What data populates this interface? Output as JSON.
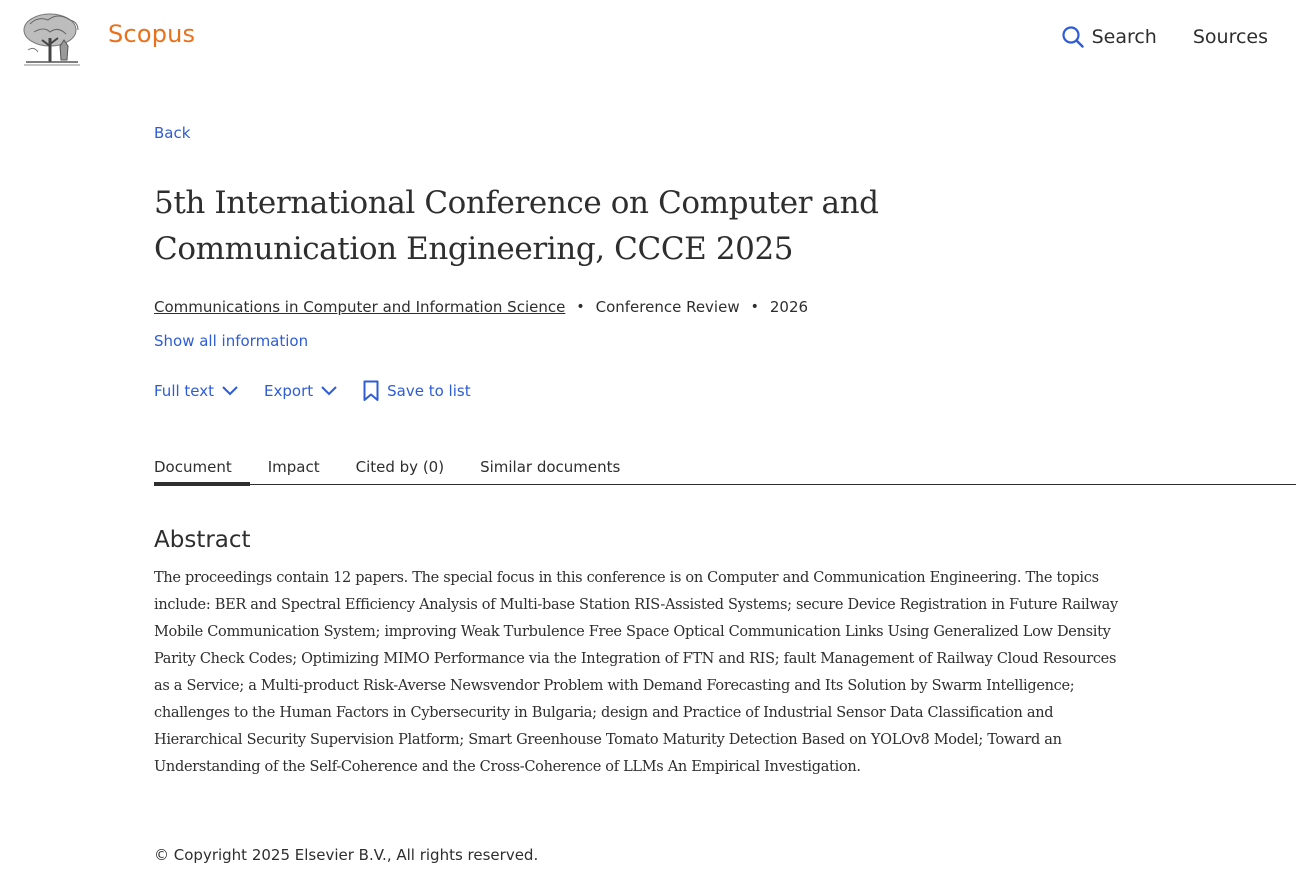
{
  "header": {
    "brand": "Scopus",
    "nav": [
      {
        "label": "Search",
        "icon": "search-icon"
      },
      {
        "label": "Sources"
      }
    ],
    "colors": {
      "brand": "#e9711c",
      "link": "#2e5cd8"
    }
  },
  "page": {
    "back_label": "Back",
    "title": "5th International Conference on Computer and Communication Engineering, CCCE 2025",
    "meta": {
      "series": "Communications in Computer and Information Science",
      "doc_type": "Conference Review",
      "year": "2026"
    },
    "show_all_label": "Show all information",
    "actions": {
      "full_text": "Full text",
      "export": "Export",
      "save_to_list": "Save to list"
    },
    "tabs": [
      {
        "label": "Document",
        "active": true
      },
      {
        "label": "Impact"
      },
      {
        "label": "Cited by (0)"
      },
      {
        "label": "Similar documents"
      }
    ],
    "abstract": {
      "heading": "Abstract",
      "text": "The proceedings contain 12 papers. The special focus in this conference is on Computer and Communication Engineering. The topics include: BER and Spectral Efficiency Analysis of Multi-base Station RIS-Assisted Systems; secure Device Registration in Future Railway Mobile Communication System; improving Weak Turbulence Free Space Optical Communication Links Using Generalized Low Density Parity Check Codes; Optimizing MIMO Performance via the Integration of FTN and RIS; fault Management of Railway Cloud Resources as a Service; a Multi-product Risk-Averse Newsvendor Problem with Demand Forecasting and Its Solution by Swarm Intelligence; challenges to the Human Factors in Cybersecurity in Bulgaria; design and Practice of Industrial Sensor Data Classification and Hierarchical Security Supervision Platform; Smart Greenhouse Tomato Maturity Detection Based on YOLOv8 Model; Toward an Understanding of the Self-Coherence and the Cross-Coherence of LLMs An Empirical Investigation."
    },
    "copyright": "© Copyright 2025 Elsevier B.V., All rights reserved."
  }
}
